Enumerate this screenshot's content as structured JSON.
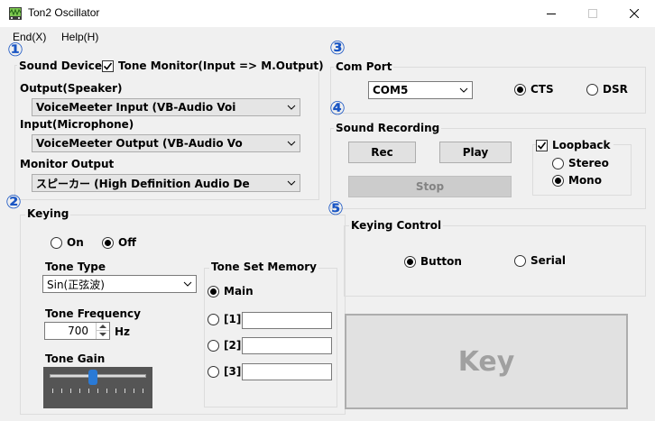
{
  "window": {
    "title": "Ton2 Oscillator"
  },
  "menu": {
    "items": [
      "End(X)",
      "Help(H)"
    ]
  },
  "badges": [
    "①",
    "②",
    "③",
    "④",
    "⑤"
  ],
  "sound_device": {
    "label": "Sound Device",
    "tone_monitor_label": "Tone Monitor(Input => M.Output)",
    "tone_monitor_checked": true,
    "output_label": "Output(Speaker)",
    "output_value": "VoiceMeeter Input (VB-Audio Voi",
    "input_label": "Input(Microphone)",
    "input_value": "VoiceMeeter Output (VB-Audio Vo",
    "monitor_label": "Monitor Output",
    "monitor_value": "スピーカー (High Definition Audio De"
  },
  "keying": {
    "label": "Keying",
    "on_label": "On",
    "off_label": "Off",
    "selected": "Off",
    "tone_type_label": "Tone Type",
    "tone_type_value": "Sin(正弦波)",
    "tone_frequency_label": "Tone Frequency",
    "tone_frequency_value": "700",
    "tone_frequency_unit": "Hz",
    "tone_gain_label": "Tone Gain",
    "tone_gain_level": 0.45,
    "memory": {
      "label": "Tone Set Memory",
      "main_label": "Main",
      "selected": "Main",
      "slots": [
        {
          "label": "[1]",
          "value": ""
        },
        {
          "label": "[2]",
          "value": ""
        },
        {
          "label": "[3]",
          "value": ""
        }
      ]
    }
  },
  "com_port": {
    "label": "Com Port",
    "port_value": "COM5",
    "cts_label": "CTS",
    "dsr_label": "DSR",
    "selected": "CTS"
  },
  "sound_recording": {
    "label": "Sound Recording",
    "rec_label": "Rec",
    "play_label": "Play",
    "stop_label": "Stop",
    "loopback_label": "Loopback",
    "loopback_checked": true,
    "stereo_label": "Stereo",
    "mono_label": "Mono",
    "selected": "Mono"
  },
  "keying_control": {
    "label": "Keying Control",
    "button_label": "Button",
    "serial_label": "Serial",
    "selected": "Button"
  },
  "key_button": {
    "label": "Key"
  },
  "icons": {
    "app": "oscillator-app-icon",
    "minimize": "minimize-icon",
    "maximize": "maximize-icon",
    "close": "close-icon",
    "dropdown": "chevron-down-icon",
    "spin": "spin-arrows-icon"
  },
  "colors": {
    "badge": "#1a56c4",
    "window_bg": "#f0f0f0",
    "key_button_bg": "#e1e1e1",
    "key_text": "#a0a0a0",
    "slider_thumb": "#2a7ad6"
  }
}
